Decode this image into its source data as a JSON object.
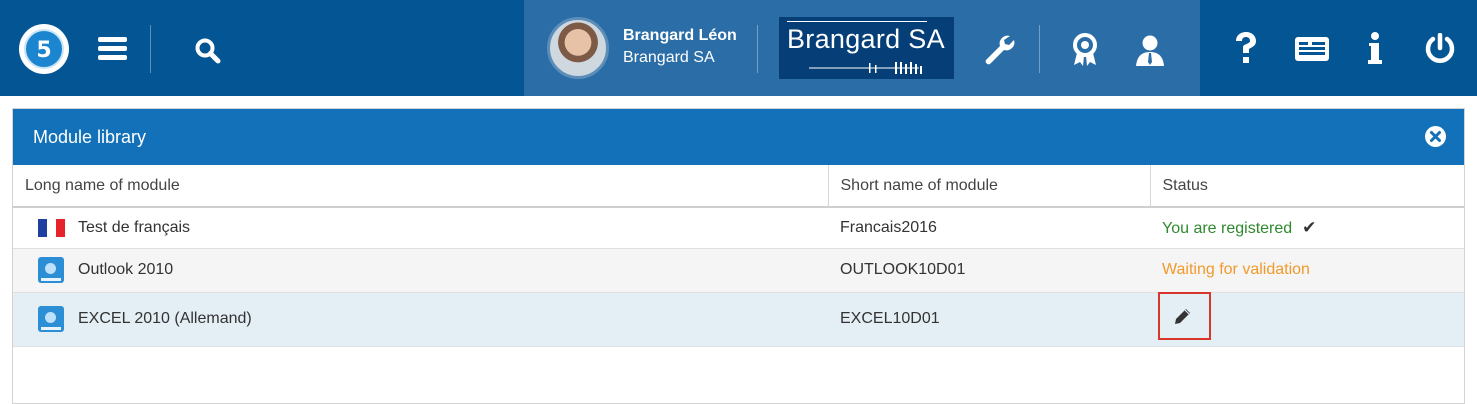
{
  "topbar": {
    "logo_number": "5",
    "user": {
      "name": "Brangard Léon",
      "company": "Brangard SA"
    },
    "company_logo_text": "Brangard SA",
    "icons": [
      "menu-icon",
      "search-icon",
      "wrench-icon",
      "award-icon",
      "user-icon",
      "help-icon",
      "id-card-icon",
      "info-icon",
      "power-icon"
    ]
  },
  "panel": {
    "title": "Module library",
    "columns": [
      "Long name of module",
      "Short name of module",
      "Status"
    ],
    "rows": [
      {
        "long_name": "Test de français",
        "short_name": "Francais2016",
        "status": "You are registered",
        "icon": "flag-france-icon"
      },
      {
        "long_name": "Outlook 2010",
        "short_name": "OUTLOOK10D01",
        "status": "Waiting for validation",
        "icon": "module-book-icon"
      },
      {
        "long_name": "EXCEL 2010 (Allemand)",
        "short_name": "EXCEL10D01",
        "status": "",
        "icon": "module-book-icon"
      }
    ]
  },
  "colors": {
    "topbar_bg": "#045593",
    "center_panel_bg": "#2b6ea7",
    "panel_header_bg": "#1271b8",
    "registered": "#2e8a2e",
    "waiting": "#f19a2b",
    "highlight_box": "#d9362b"
  }
}
